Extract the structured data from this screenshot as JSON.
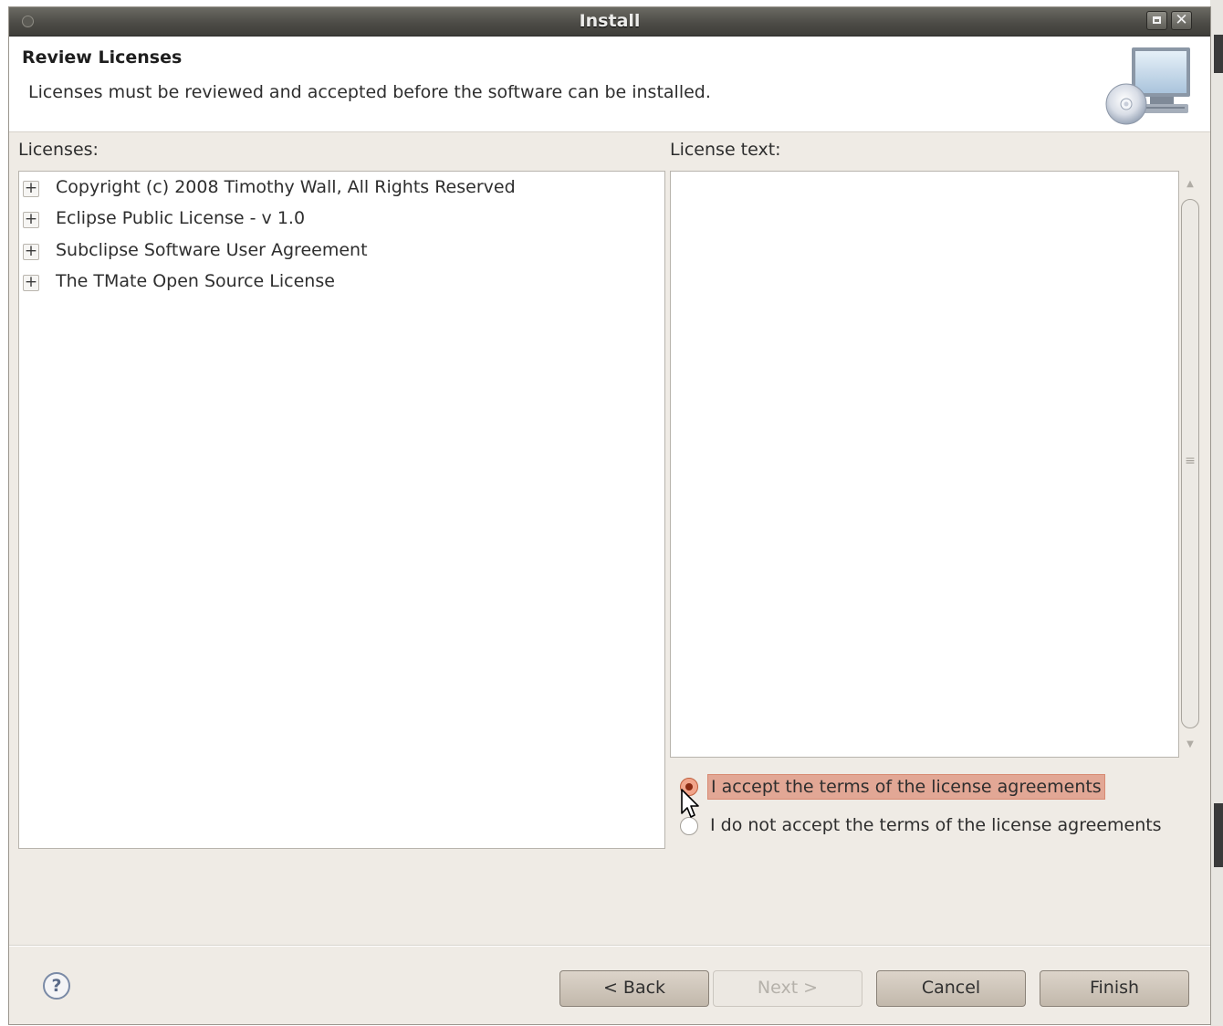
{
  "window": {
    "title": "Install"
  },
  "header": {
    "title": "Review Licenses",
    "description": "Licenses must be reviewed and accepted before the software can be installed."
  },
  "licenses": {
    "label": "Licenses:",
    "items": [
      {
        "expander": "+",
        "label": "Copyright (c) 2008 Timothy Wall, All Rights Reserved"
      },
      {
        "expander": "+",
        "label": "Eclipse Public License - v 1.0"
      },
      {
        "expander": "+",
        "label": "Subclipse Software User Agreement"
      },
      {
        "expander": "+",
        "label": "The TMate Open Source License"
      }
    ]
  },
  "license_text": {
    "label": "License text:",
    "value": ""
  },
  "agreement": {
    "accept_label": "I accept the terms of the license agreements",
    "decline_label": "I do not accept the terms of the license agreements",
    "selected": "accept"
  },
  "buttons": {
    "help": "?",
    "back": "< Back",
    "next": "Next >",
    "cancel": "Cancel",
    "finish": "Finish"
  },
  "colors": {
    "titlebar": "#4d4c47",
    "dialog_bg": "#efebe5",
    "selection": "#e2a795",
    "button": "#c9bfb3"
  },
  "icons": [
    "monitor-cd-icon",
    "expand-icon",
    "help-icon",
    "mouse-cursor-icon"
  ]
}
